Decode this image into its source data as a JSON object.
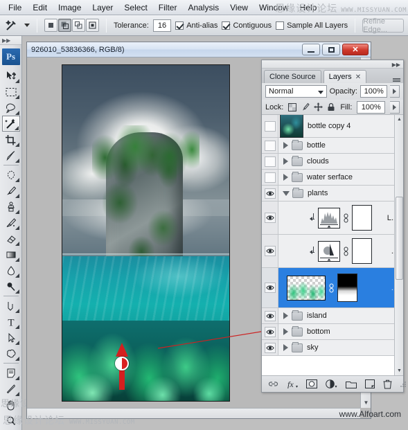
{
  "app": {
    "name": "Adobe Photoshop",
    "logo_text": "Ps"
  },
  "menubar": {
    "items": [
      {
        "label": "File"
      },
      {
        "label": "Edit"
      },
      {
        "label": "Image"
      },
      {
        "label": "Layer"
      },
      {
        "label": "Select"
      },
      {
        "label": "Filter"
      },
      {
        "label": "Analysis"
      },
      {
        "label": "View"
      },
      {
        "label": "Window"
      },
      {
        "label": "Help"
      }
    ]
  },
  "watermark": {
    "cn": "思缘设计论坛",
    "en": "WWW.MISSYUAN.COM",
    "cn_bottom": "思缘设计论坛",
    "en_bottom": "WWW.MISSYUAN.COM",
    "tool_overlay": "思缘设",
    "alfoart": "www.Alfoart.com"
  },
  "options_bar": {
    "tool_icon": "magic-wand-icon",
    "selection_modes": [
      "new-selection",
      "add-to-selection",
      "subtract-from-selection",
      "intersect-with-selection"
    ],
    "active_selection_mode": 1,
    "tolerance_label": "Tolerance:",
    "tolerance_value": "16",
    "anti_alias_label": "Anti-alias",
    "anti_alias_checked": true,
    "contiguous_label": "Contiguous",
    "contiguous_checked": true,
    "sample_all_layers_label": "Sample All Layers",
    "sample_all_layers_checked": false,
    "refine_edge_label": "Refine Edge...",
    "refine_edge_disabled": true
  },
  "toolbox": {
    "tools": [
      {
        "name": "move-tool",
        "icon": "move-icon",
        "has_flyout": true,
        "selected": false
      },
      {
        "name": "marquee-tool",
        "icon": "rectangular-marquee-icon",
        "has_flyout": true,
        "selected": false
      },
      {
        "name": "lasso-tool",
        "icon": "lasso-icon",
        "has_flyout": true,
        "selected": false
      },
      {
        "name": "magic-wand-tool",
        "icon": "magic-wand-icon",
        "has_flyout": true,
        "selected": true
      },
      {
        "name": "crop-tool",
        "icon": "crop-icon",
        "has_flyout": true,
        "selected": false
      },
      {
        "name": "eyedropper-slice-tool",
        "icon": "slice-icon",
        "has_flyout": true,
        "selected": false
      },
      {
        "name": "healing-brush-tool",
        "icon": "spot-healing-icon",
        "has_flyout": true,
        "selected": false
      },
      {
        "name": "brush-tool",
        "icon": "brush-icon",
        "has_flyout": true,
        "selected": false
      },
      {
        "name": "clone-stamp-tool",
        "icon": "clone-stamp-icon",
        "has_flyout": true,
        "selected": false
      },
      {
        "name": "history-brush-tool",
        "icon": "history-brush-icon",
        "has_flyout": true,
        "selected": false
      },
      {
        "name": "eraser-tool",
        "icon": "eraser-icon",
        "has_flyout": true,
        "selected": false
      },
      {
        "name": "gradient-tool",
        "icon": "gradient-icon",
        "has_flyout": true,
        "selected": false
      },
      {
        "name": "blur-tool",
        "icon": "blur-droplet-icon",
        "has_flyout": true,
        "selected": false
      },
      {
        "name": "dodge-tool",
        "icon": "dodge-icon",
        "has_flyout": true,
        "selected": false
      },
      {
        "name": "pen-tool",
        "icon": "pen-icon",
        "has_flyout": true,
        "selected": false
      },
      {
        "name": "type-tool",
        "icon": "type-t-icon",
        "has_flyout": true,
        "selected": false
      },
      {
        "name": "path-selection-tool",
        "icon": "path-arrow-icon",
        "has_flyout": true,
        "selected": false
      },
      {
        "name": "shape-tool",
        "icon": "custom-shape-icon",
        "has_flyout": true,
        "selected": false
      },
      {
        "name": "notes-tool",
        "icon": "note-icon",
        "has_flyout": true,
        "selected": false
      },
      {
        "name": "eyedropper-tool",
        "icon": "eyedropper-icon",
        "has_flyout": true,
        "selected": false
      },
      {
        "name": "hand-tool",
        "icon": "hand-icon",
        "has_flyout": false,
        "selected": false
      },
      {
        "name": "zoom-tool",
        "icon": "zoom-magnifier-icon",
        "has_flyout": false,
        "selected": false
      }
    ]
  },
  "document_window": {
    "title": "926010_53836366, RGB/8)",
    "minimize_label": "minimize-icon",
    "maximize_label": "maximize-icon",
    "close_label": "✕"
  },
  "layers_panel": {
    "tabs": [
      {
        "label": "Clone Source",
        "active": false,
        "closable": false
      },
      {
        "label": "Layers",
        "active": true,
        "closable": true,
        "close_glyph": "✕"
      }
    ],
    "blend_mode": "Normal",
    "opacity_label": "Opacity:",
    "opacity_value": "100%",
    "lock_label": "Lock:",
    "lock_icons": [
      "lock-transparency-icon",
      "lock-image-icon",
      "lock-position-icon",
      "lock-all-icon"
    ],
    "fill_label": "Fill:",
    "fill_value": "100%",
    "layers": [
      {
        "name": "bottle copy 4",
        "type": "image",
        "visible": false,
        "expanded": false,
        "selected": false,
        "thumb": "bottle",
        "partial": true
      },
      {
        "name": "bottle",
        "type": "group",
        "visible": false,
        "expanded": false,
        "selected": false
      },
      {
        "name": "clouds",
        "type": "group",
        "visible": false,
        "expanded": false,
        "selected": false
      },
      {
        "name": "water serface",
        "type": "group",
        "visible": false,
        "expanded": false,
        "selected": false
      },
      {
        "name": "plants",
        "type": "group",
        "visible": true,
        "expanded": true,
        "selected": false
      },
      {
        "name": "L...",
        "type": "adjustment-levels",
        "visible": true,
        "clipped": true,
        "selected": false,
        "icon": "levels-histogram-icon",
        "has_mask": true
      },
      {
        "name": "...",
        "type": "adjustment-huesat",
        "visible": true,
        "clipped": true,
        "selected": false,
        "icon": "hue-saturation-icon",
        "has_mask": true
      },
      {
        "name": "...",
        "type": "image-with-mask",
        "visible": true,
        "selected": true,
        "icon": "plants-thumbnail",
        "has_mask": true,
        "mask_type": "black-to-white-gradient"
      },
      {
        "name": "island",
        "type": "group",
        "visible": true,
        "expanded": false,
        "selected": false
      },
      {
        "name": "bottom",
        "type": "group",
        "visible": true,
        "expanded": false,
        "selected": false
      },
      {
        "name": "sky",
        "type": "group",
        "visible": true,
        "expanded": false,
        "selected": false
      }
    ],
    "footer_icons": [
      "link-layers-icon",
      "layer-style-fx-icon",
      "add-layer-mask-icon",
      "new-adjustment-layer-icon",
      "new-group-icon",
      "new-layer-icon",
      "delete-layer-icon"
    ]
  },
  "annotation": {
    "arrow_color": "#d41f1f",
    "arrow_direction": "up",
    "description": "gradient-drag-arrow",
    "guide_line_color": "#cc2222"
  }
}
